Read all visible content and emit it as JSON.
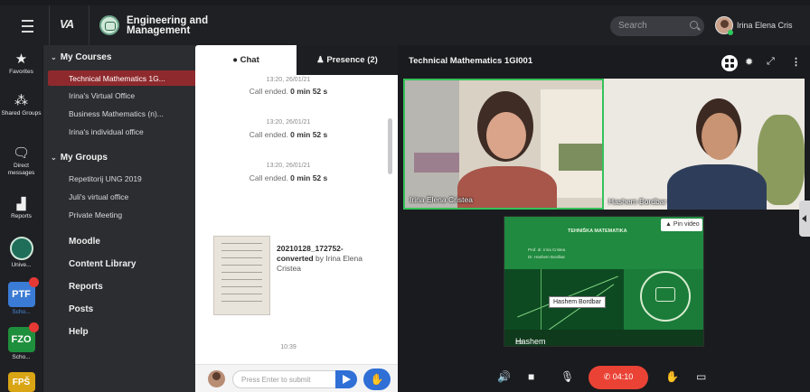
{
  "topbar": {
    "logo": "VA",
    "org_name": "Engineering and Management",
    "search_placeholder": "Search",
    "user_name": "Irina Elena Cris"
  },
  "rail": {
    "items": [
      {
        "label": "Favorites",
        "icon": "star-icon"
      },
      {
        "label": "Shared Groups",
        "icon": "share-icon"
      },
      {
        "label": "Direct messages",
        "icon": "chat-bubble-icon"
      },
      {
        "label": "Reports",
        "icon": "chart-icon"
      },
      {
        "label": "Unive...",
        "icon": "university-logo"
      },
      {
        "label": "PTF",
        "sub": "Scho...",
        "color": "#3a7bd5"
      },
      {
        "label": "FZO",
        "sub": "Scho...",
        "color": "#1e8f3c"
      },
      {
        "label": "FPŠ",
        "sub": "",
        "color": "#d9a514"
      }
    ]
  },
  "nav": {
    "my_courses": "My Courses",
    "courses": [
      "Technical Mathematics 1G...",
      "Irina's Virtual Office",
      "Business Mathematics (n)...",
      "Irina's individual office"
    ],
    "my_groups": "My Groups",
    "groups": [
      "Repetitorij UNG 2019",
      "Juli's virtual office",
      "Private Meeting"
    ],
    "links": [
      "Moodle",
      "Content Library",
      "Reports",
      "Posts",
      "Help"
    ]
  },
  "chat": {
    "tab_chat": "Chat",
    "tab_presence": "Presence (2)",
    "messages": [
      {
        "time": "13:20, 26/01/21",
        "text_prefix": "Call ended.",
        "text_bold": "0 min 52 s"
      },
      {
        "time": "13:20, 26/01/21",
        "text_prefix": "Call ended.",
        "text_bold": "0 min 52 s"
      },
      {
        "time": "13:20, 26/01/21",
        "text_prefix": "Call ended.",
        "text_bold": "0 min 52 s"
      }
    ],
    "file": {
      "name": "20210128_172752-converted",
      "by": "by Irina Elena Cristea"
    },
    "last_time": "10:39",
    "input_placeholder": "Press Enter to submit"
  },
  "video": {
    "title": "Technical Mathematics 1GI001",
    "participants": [
      {
        "name": "Irina Elena Cristea",
        "active_speaker": true
      },
      {
        "name": "Hashem Bordbar",
        "active_speaker": false
      }
    ],
    "share": {
      "owner": "Hashem Bordbar",
      "pin_label": "Pin video",
      "tooltip": "Hashem Bordbar",
      "slide_title": "TEHNIŠKA MATEMATIKA",
      "slide_lines": [
        "Prof. dr. Irina Cristea",
        "Dr. Hashem Bordbar"
      ]
    },
    "call_timer": "04:10"
  },
  "colors": {
    "active_course": "#8e2a2d",
    "speaker_border": "#35c25a",
    "hangup": "#ea4335",
    "primary": "#2f6fd6"
  }
}
